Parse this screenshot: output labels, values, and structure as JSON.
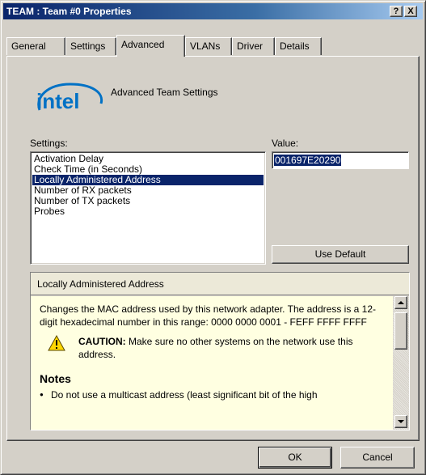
{
  "window": {
    "title": "TEAM : Team #0 Properties",
    "help_button": "?",
    "close_button": "X"
  },
  "tabs": [
    {
      "label": "General",
      "active": false
    },
    {
      "label": "Settings",
      "active": false
    },
    {
      "label": "Advanced",
      "active": true
    },
    {
      "label": "VLANs",
      "active": false
    },
    {
      "label": "Driver",
      "active": false
    },
    {
      "label": "Details",
      "active": false
    }
  ],
  "header": {
    "logo_text": "intel",
    "title": "Advanced Team Settings"
  },
  "settings": {
    "label": "Settings:",
    "label_accesskey": "S",
    "items": [
      {
        "label": "Activation Delay",
        "selected": false
      },
      {
        "label": "Check Time (in Seconds)",
        "selected": false
      },
      {
        "label": "Locally Administered Address",
        "selected": true
      },
      {
        "label": "Number of RX packets",
        "selected": false
      },
      {
        "label": "Number of TX packets",
        "selected": false
      },
      {
        "label": "Probes",
        "selected": false
      }
    ]
  },
  "value": {
    "label": "Value:",
    "label_accesskey": "V",
    "current": "001697E20290"
  },
  "use_default_button": {
    "label": "Use Default",
    "accesskey": "D"
  },
  "help": {
    "heading": "Locally Administered Address",
    "description": "Changes the MAC address used by this network adapter. The address is a 12-digit hexadecimal number in this range: 0000 0000 0001 - FEFF FFFF FFFF",
    "caution_label": "CAUTION:",
    "caution_text": "Make sure no other systems on the network use this address.",
    "notes_title": "Notes",
    "notes": [
      "Do not use a multicast address (least significant bit of the high"
    ]
  },
  "footer": {
    "ok_label": "OK",
    "cancel_label": "Cancel"
  },
  "colors": {
    "selection": "#0a246a",
    "help_background": "#ffffe1",
    "intel_blue": "#0071c5"
  }
}
